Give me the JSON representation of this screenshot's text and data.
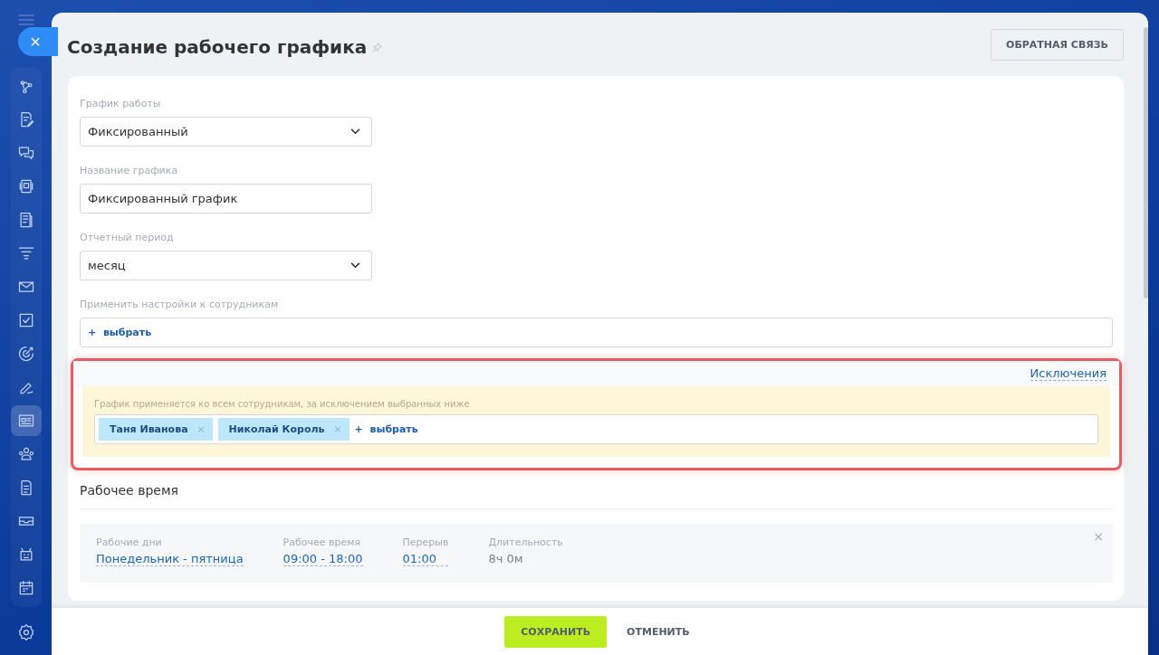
{
  "sidebar": {
    "items": [
      {
        "selected": false
      },
      {
        "selected": false
      },
      {
        "selected": false
      },
      {
        "selected": false
      },
      {
        "selected": false
      },
      {
        "selected": false
      },
      {
        "selected": false
      },
      {
        "selected": false
      },
      {
        "selected": false
      },
      {
        "selected": false
      },
      {
        "selected": true
      },
      {
        "selected": false
      },
      {
        "selected": false
      },
      {
        "selected": false
      },
      {
        "selected": false
      },
      {
        "selected": false
      }
    ]
  },
  "close_button": "×",
  "page": {
    "title": "Создание рабочего графика",
    "feedback_button": "ОБРАТНАЯ СВЯЗЬ"
  },
  "form": {
    "fields": [
      {
        "kind": "select",
        "label": "График работы",
        "value": "Фиксированный"
      },
      {
        "kind": "text",
        "label": "Название графика",
        "value": "Фиксированный график"
      },
      {
        "kind": "select",
        "label": "Отчетный период",
        "value": "месяц"
      },
      {
        "kind": "picker",
        "label": "Применить настройки к сотрудникам",
        "plus": "+",
        "action": "выбрать"
      }
    ]
  },
  "exclusions": {
    "link": "Исключения",
    "note": "График применяется ко всем сотрудникам, за исключением выбранных ниже",
    "tags": [
      {
        "name": "Таня Иванова",
        "remove": "×"
      },
      {
        "name": "Николай Король",
        "remove": "×"
      }
    ],
    "plus": "+",
    "action": "выбрать"
  },
  "work_time": {
    "title": "Рабочее время",
    "remove": "×",
    "columns": [
      {
        "label": "Рабочие дни",
        "value": "Понедельник - пятница",
        "kind": "link"
      },
      {
        "label": "Рабочее время",
        "value": "09:00 - 18:00",
        "kind": "link"
      },
      {
        "label": "Перерыв",
        "value": "01:00",
        "kind": "link"
      },
      {
        "label": "Длительность",
        "value": "8ч 0м",
        "kind": "text"
      }
    ]
  },
  "footer": {
    "save": "СОХРАНИТЬ",
    "cancel": "ОТМЕНИТЬ"
  }
}
